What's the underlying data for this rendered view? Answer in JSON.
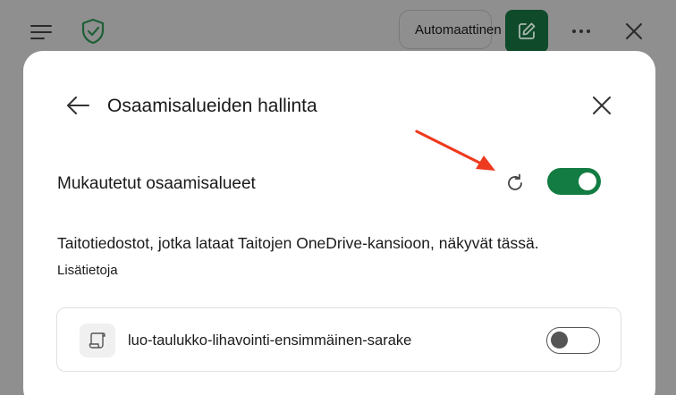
{
  "topbar": {
    "mode_label": "Automaattinen",
    "icons": {
      "menu": "hamburger-menu-icon",
      "shield": "shield-check-icon",
      "compose": "compose-edit-icon",
      "more": "more-ellipsis-icon",
      "close": "close-icon"
    }
  },
  "dialog": {
    "title": "Osaamisalueiden hallinta",
    "section_label": "Mukautetut osaamisalueet",
    "custom_skills_enabled": true,
    "description": "Taitotiedostot, jotka lataat Taitojen OneDrive-kansioon, näkyvät tässä.",
    "learn_more": "Lisätietoja",
    "skills": [
      {
        "name": "luo-taulukko-lihavointi-ensimmäinen-sarake",
        "enabled": false
      }
    ]
  },
  "colors": {
    "accent_green": "#137c42",
    "compose_green": "#0f4a2a",
    "shield_green": "#1f7a43",
    "annotation_red": "#ee3a1f",
    "overlay_gray": "#8f8f8f"
  }
}
